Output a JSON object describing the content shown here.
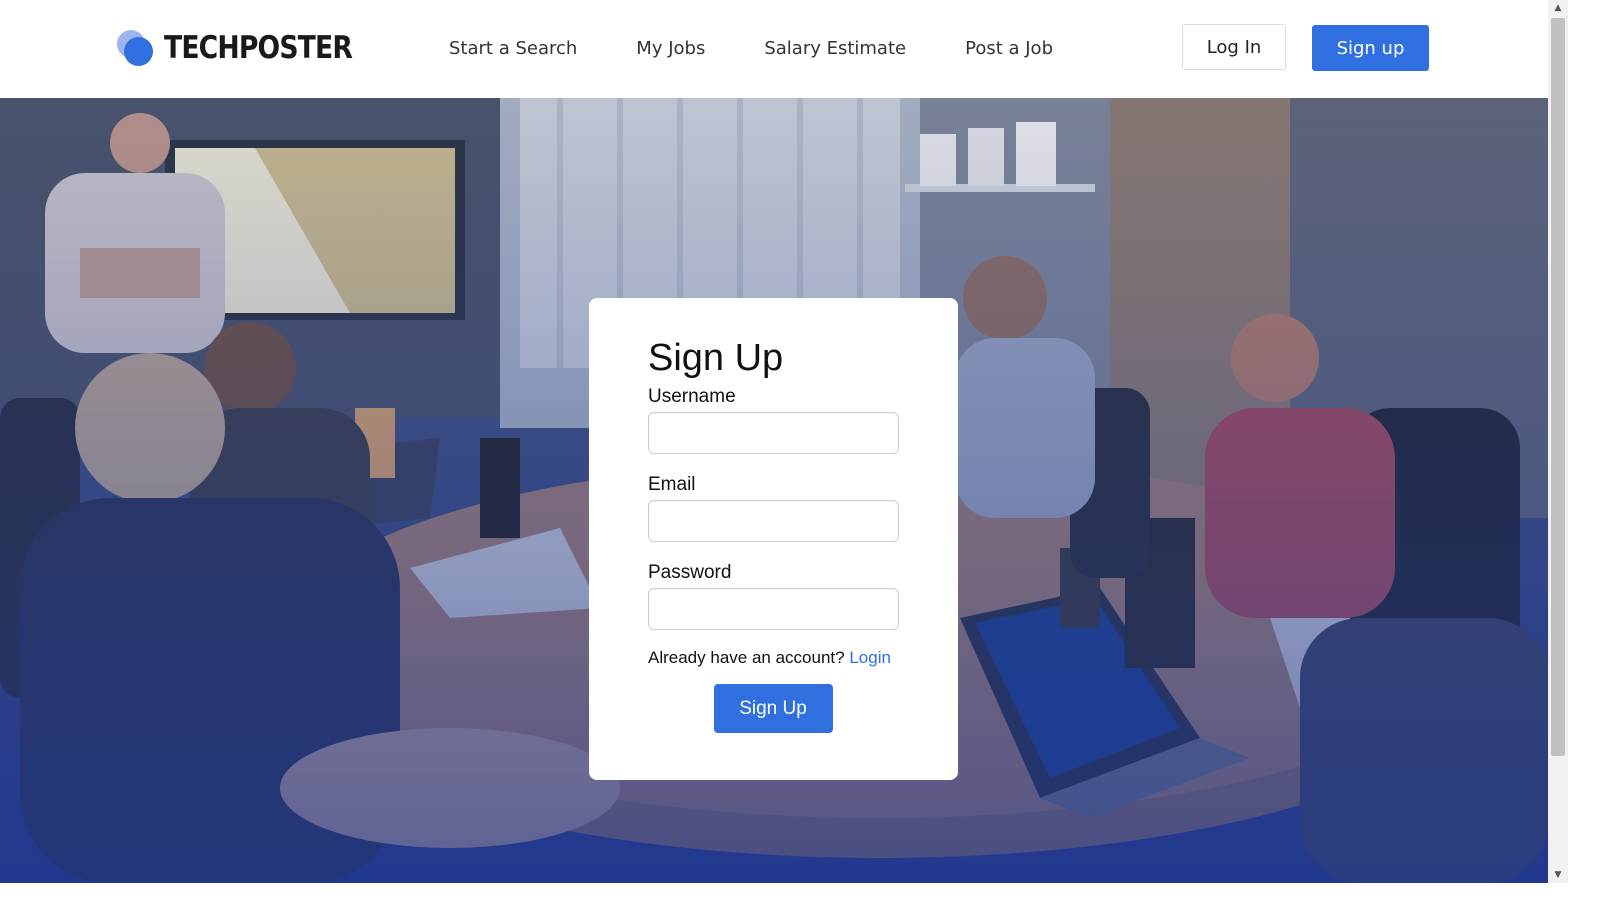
{
  "brand": {
    "name": "TECHPOSTER",
    "colors": {
      "primary": "#2f6fe0",
      "logo_light": "#9fb4ee"
    }
  },
  "nav": {
    "items": [
      {
        "label": "Start a Search"
      },
      {
        "label": "My Jobs"
      },
      {
        "label": "Salary Estimate"
      },
      {
        "label": "Post a Job"
      }
    ],
    "login_label": "Log In",
    "signup_label": "Sign up"
  },
  "form": {
    "title": "Sign Up",
    "username": {
      "label": "Username",
      "value": "",
      "placeholder": ""
    },
    "email": {
      "label": "Email",
      "value": "",
      "placeholder": ""
    },
    "password": {
      "label": "Password",
      "value": "",
      "placeholder": ""
    },
    "already_text": "Already have an account?",
    "login_link": "Login",
    "submit_label": "Sign Up"
  },
  "hero": {
    "image": "meeting-room-photo"
  },
  "icons": {
    "scroll_up": "scroll-up-arrow-icon",
    "scroll_down": "scroll-down-arrow-icon"
  }
}
